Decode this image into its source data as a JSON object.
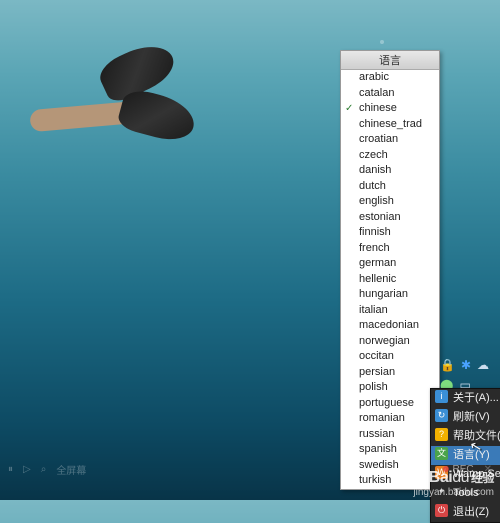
{
  "language_menu": {
    "title": "语言",
    "selected": "chinese",
    "items": [
      "arabic",
      "catalan",
      "chinese",
      "chinese_trad",
      "croatian",
      "czech",
      "danish",
      "dutch",
      "english",
      "estonian",
      "finnish",
      "french",
      "german",
      "hellenic",
      "hungarian",
      "italian",
      "macedonian",
      "norwegian",
      "occitan",
      "persian",
      "polish",
      "portuguese",
      "romanian",
      "russian",
      "spanish",
      "swedish",
      "turkish"
    ]
  },
  "tray_menu": {
    "items": [
      {
        "icon": "about",
        "label": "关于(A)...",
        "submenu": false
      },
      {
        "icon": "refresh",
        "label": "刷新(V)",
        "submenu": false
      },
      {
        "icon": "help",
        "label": "帮助文件(X)",
        "submenu": false
      },
      {
        "icon": "lang",
        "label": "语言(Y)",
        "submenu": true,
        "highlight": true
      },
      {
        "icon": "wamp",
        "label": "Wamp Settings",
        "submenu": true
      },
      {
        "icon": "tools",
        "label": "Tools",
        "submenu": true
      },
      {
        "icon": "exit",
        "label": "退出(Z)",
        "submenu": false
      }
    ]
  },
  "systray_icons": [
    "lock-icon",
    "bluetooth-icon",
    "cloud-icon",
    "wamp-icon",
    "action-icon",
    "more-icon"
  ],
  "bottom_bar": {
    "controls": [
      "⏸",
      "▷",
      "⬚",
      "⤢"
    ],
    "fullscreen_label": "全屏幕",
    "rec_label": "REC",
    "close": "✕"
  },
  "watermark": {
    "brand_a": "Bai",
    "brand_b": "du",
    "brand_c": "经验",
    "url": "jingyan.baidu.com"
  }
}
